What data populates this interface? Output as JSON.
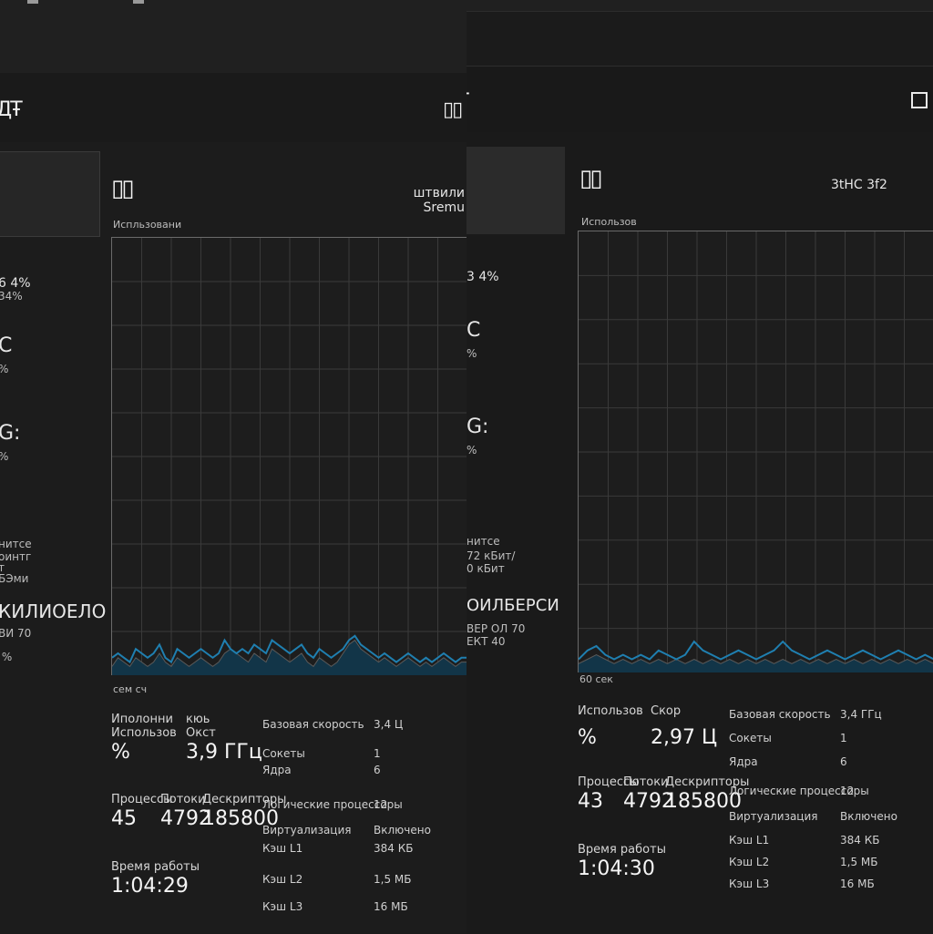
{
  "colors": {
    "background": "#1b1b1b",
    "graph_line": "#1f7fb0",
    "graph_fill": "#123548",
    "grid": "#3a3a3a"
  },
  "left": {
    "header_glyph": "ДŦ",
    "restore_glyph": "▯▯",
    "sidebar": {
      "entry1": "",
      "pct1": "6 4%",
      "pct1b": "34%",
      "item2_a": "C",
      "item2_b": "%",
      "item3_a": "G:",
      "item3_b": "%",
      "net_a": "нитсе",
      "net_b": "оинтг",
      "net_c": "т",
      "net_d": "БЭми",
      "gpu_a": "КИЛИОЕЛО",
      "gpu_b": "ВИ 70",
      "gpu_c": " %"
    },
    "chart": {
      "icon": "▯▯",
      "label_top": "Испльзовани",
      "name_right_1": "штвили",
      "name_right_2": "Sremu",
      "label_bottom": "сем сч"
    },
    "stats": {
      "util_label_1": "Иполонни",
      "util_label_2": "Использов",
      "util_value": "%",
      "speed_label_1": "кюь",
      "speed_label_2": "Окст",
      "speed_value": "3,9 ГГц",
      "proc_label": "Процессы",
      "proc_value": "45",
      "threads_label": "Потоки",
      "threads_value": "4792",
      "handles_label": "Дескрипторы",
      "handles_value": "185800",
      "uptime_label": "Время работы",
      "uptime_value": "1:04:29"
    },
    "kv": {
      "base_speed_label": "Базовая скорость",
      "base_speed_value": "3,4 Ц",
      "sockets_label": "Сокеты",
      "sockets_value": "1",
      "cores_label": "Ядра",
      "cores_value": "6",
      "logical_label": "Логические процессоры",
      "logical_value": "12",
      "virt_label": "Виртуализация",
      "virt_value": "Включено",
      "l1_label": "Кэш L1",
      "l1_value": "384 КБ",
      "l2_label": "Кэш L2",
      "l2_value": "1,5 МБ",
      "l3_label": "Кэш L3",
      "l3_value": "16 МБ"
    }
  },
  "right": {
    "header_glyph": "ДŦ",
    "sidebar": {
      "pct1": "3 4%",
      "item2_a": "C",
      "item2_b": "%",
      "item3_a": "G:",
      "item3_b": "%",
      "net_a": "нитсе",
      "net_b": "72 кБит/",
      "net_c": "0 кБит",
      "gpu_a": "ОИЛБЕРСИ",
      "gpu_b": "ВЕР ОЛ 70",
      "gpu_c": "ЕКТ 40"
    },
    "chart": {
      "icon": "▯▯",
      "label_top": "Использов",
      "name_right_1": "3tHC 3f2",
      "name_right_2": "",
      "label_bottom": "60 сек"
    },
    "stats": {
      "util_label": "Использов",
      "util_value": "%",
      "speed_label": "Скор",
      "speed_value": "2,97 Ц",
      "proc_label": "Процессы",
      "proc_value": "43",
      "threads_label": "Потоки",
      "threads_value": "4792",
      "handles_label": "Дескрипторы",
      "handles_value": "185800",
      "uptime_label": "Время работы",
      "uptime_value": "1:04:30"
    },
    "kv": {
      "base_speed_label": "Базовая скорость",
      "base_speed_value": "3,4 ГГц",
      "sockets_label": "Сокеты",
      "sockets_value": "1",
      "cores_label": "Ядра",
      "cores_value": "6",
      "logical_label": "Логические процессоры",
      "logical_value": "12",
      "virt_label": "Виртуализация",
      "virt_value": "Включено",
      "l1_label": "Кэш L1",
      "l1_value": "384 КБ",
      "l2_label": "Кэш L2",
      "l2_value": "1,5 МБ",
      "l3_label": "Кэш L3",
      "l3_value": "16 МБ"
    }
  },
  "chart_data": [
    {
      "type": "area",
      "ylim": [
        0,
        100
      ],
      "x": [
        0,
        1,
        2,
        3,
        4,
        5,
        6,
        7,
        8,
        9,
        10,
        11,
        12,
        13,
        14,
        15,
        16,
        17,
        18,
        19,
        20,
        21,
        22,
        23,
        24,
        25,
        26,
        27,
        28,
        29,
        30,
        31,
        32,
        33,
        34,
        35,
        36,
        37,
        38,
        39,
        40,
        41,
        42,
        43,
        44,
        45,
        46,
        47,
        48,
        49,
        50,
        51,
        52,
        53,
        54,
        55,
        56,
        57,
        58,
        59,
        60
      ],
      "xlabel": "",
      "ylabel": "",
      "grid": true,
      "series": [
        {
          "values": [
            2,
            4,
            3,
            2,
            4,
            3,
            2,
            3,
            5,
            3,
            2,
            4,
            3,
            2,
            3,
            4,
            3,
            2,
            3,
            5,
            6,
            5,
            4,
            3,
            5,
            4,
            3,
            6,
            5,
            4,
            3,
            4,
            5,
            3,
            2,
            4,
            3,
            2,
            3,
            5,
            7,
            8,
            6,
            5,
            4,
            3,
            4,
            3,
            2,
            3,
            4,
            3,
            2,
            3,
            2,
            3,
            4,
            3,
            2,
            3,
            3
          ]
        },
        {
          "values": [
            4,
            5,
            4,
            3,
            6,
            5,
            4,
            5,
            7,
            4,
            3,
            6,
            5,
            4,
            5,
            6,
            5,
            4,
            5,
            8,
            6,
            5,
            6,
            5,
            7,
            6,
            5,
            8,
            7,
            6,
            5,
            6,
            7,
            5,
            4,
            6,
            5,
            4,
            5,
            6,
            8,
            9,
            7,
            6,
            5,
            4,
            5,
            4,
            3,
            4,
            5,
            4,
            3,
            4,
            3,
            4,
            5,
            4,
            3,
            4,
            4
          ]
        }
      ]
    },
    {
      "type": "area",
      "ylim": [
        0,
        100
      ],
      "x": [
        0,
        1,
        2,
        3,
        4,
        5,
        6,
        7,
        8,
        9,
        10,
        11,
        12,
        13,
        14,
        15,
        16,
        17,
        18,
        19,
        20,
        21,
        22,
        23,
        24,
        25,
        26,
        27,
        28,
        29,
        30,
        31,
        32,
        33,
        34,
        35,
        36,
        37,
        38,
        39,
        40
      ],
      "xlabel": "",
      "ylabel": "",
      "grid": true,
      "series": [
        {
          "values": [
            2,
            3,
            4,
            3,
            2,
            3,
            2,
            3,
            2,
            3,
            2,
            3,
            2,
            3,
            2,
            3,
            2,
            3,
            2,
            3,
            2,
            3,
            2,
            3,
            2,
            3,
            2,
            3,
            2,
            3,
            2,
            3,
            2,
            3,
            2,
            3,
            2,
            3,
            2,
            3,
            2
          ]
        },
        {
          "values": [
            3,
            5,
            6,
            4,
            3,
            4,
            3,
            4,
            3,
            5,
            4,
            3,
            4,
            7,
            5,
            4,
            3,
            4,
            5,
            4,
            3,
            4,
            5,
            7,
            5,
            4,
            3,
            4,
            5,
            4,
            3,
            4,
            5,
            4,
            3,
            4,
            5,
            4,
            3,
            4,
            3
          ]
        }
      ]
    }
  ]
}
